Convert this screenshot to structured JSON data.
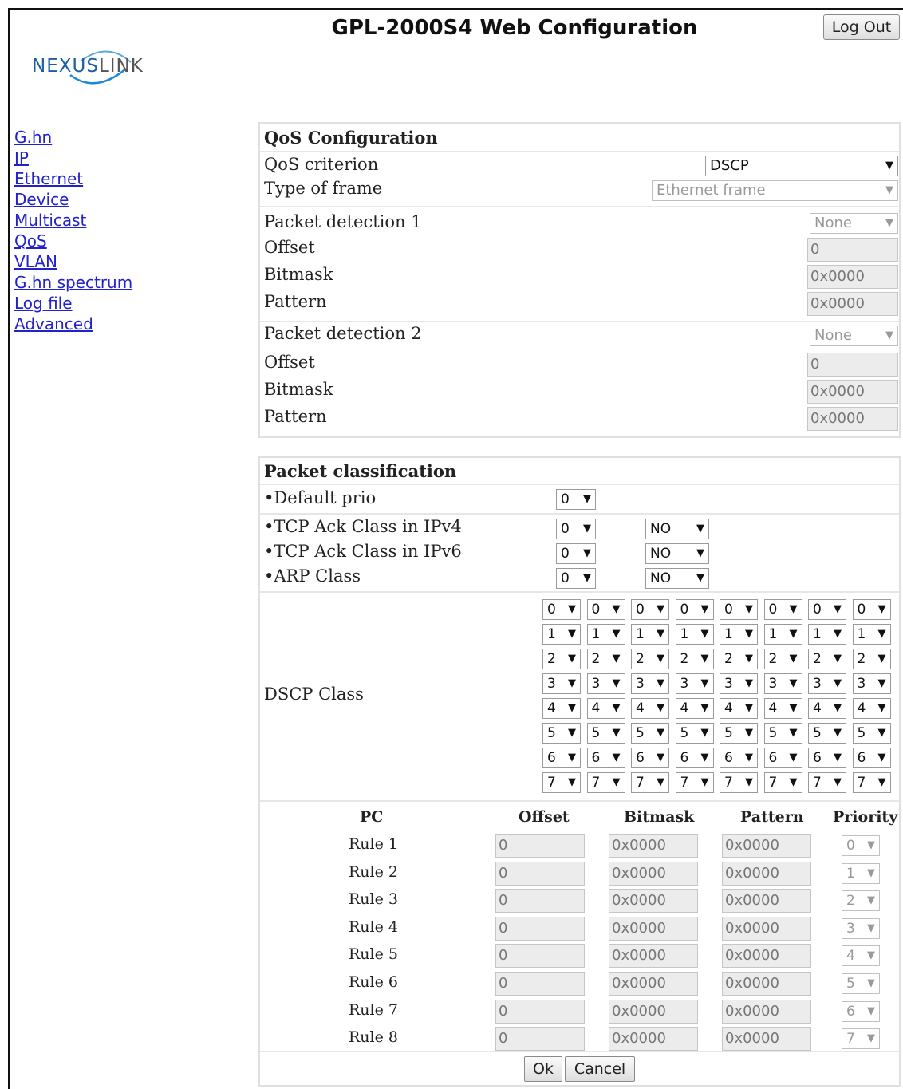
{
  "header": {
    "title": "GPL-2000S4 Web Configuration",
    "logout_label": "Log Out",
    "logo_prefix": "NEX",
    "logo_mid": "US",
    "logo_suffix": "LINK"
  },
  "nav": {
    "items": [
      "G.hn",
      "IP",
      "Ethernet",
      "Device",
      "Multicast",
      "QoS",
      "VLAN",
      "G.hn spectrum",
      "Log file",
      "Advanced"
    ]
  },
  "qos": {
    "title": "QoS Configuration",
    "criterion_label": "QoS criterion",
    "criterion_value": "DSCP",
    "frame_label": "Type of frame",
    "frame_value": "Ethernet frame",
    "detection1": {
      "label": "Packet detection 1",
      "mode": "None",
      "offset_label": "Offset",
      "offset": "0",
      "bitmask_label": "Bitmask",
      "bitmask": "0x0000",
      "pattern_label": "Pattern",
      "pattern": "0x0000"
    },
    "detection2": {
      "label": "Packet detection 2",
      "mode": "None",
      "offset_label": "Offset",
      "offset": "0",
      "bitmask_label": "Bitmask",
      "bitmask": "0x0000",
      "pattern_label": "Pattern",
      "pattern": "0x0000"
    }
  },
  "classification": {
    "title": "Packet classification",
    "default_prio_label": "•Default prio",
    "default_prio": "0",
    "tcp_ipv4_label": "•TCP Ack Class in IPv4",
    "tcp_ipv4_prio": "0",
    "tcp_ipv4_enable": "NO",
    "tcp_ipv6_label": "•TCP Ack Class in IPv6",
    "tcp_ipv6_prio": "0",
    "tcp_ipv6_enable": "NO",
    "arp_label": "•ARP Class",
    "arp_prio": "0",
    "arp_enable": "NO",
    "dscp_label": "DSCP Class",
    "dscp_rows": [
      [
        "0",
        "0",
        "0",
        "0",
        "0",
        "0",
        "0",
        "0"
      ],
      [
        "1",
        "1",
        "1",
        "1",
        "1",
        "1",
        "1",
        "1"
      ],
      [
        "2",
        "2",
        "2",
        "2",
        "2",
        "2",
        "2",
        "2"
      ],
      [
        "3",
        "3",
        "3",
        "3",
        "3",
        "3",
        "3",
        "3"
      ],
      [
        "4",
        "4",
        "4",
        "4",
        "4",
        "4",
        "4",
        "4"
      ],
      [
        "5",
        "5",
        "5",
        "5",
        "5",
        "5",
        "5",
        "5"
      ],
      [
        "6",
        "6",
        "6",
        "6",
        "6",
        "6",
        "6",
        "6"
      ],
      [
        "7",
        "7",
        "7",
        "7",
        "7",
        "7",
        "7",
        "7"
      ]
    ],
    "rules_headers": {
      "pc": "PC",
      "offset": "Offset",
      "bitmask": "Bitmask",
      "pattern": "Pattern",
      "priority": "Priority"
    },
    "rules": [
      {
        "name": "Rule 1",
        "offset": "0",
        "bitmask": "0x0000",
        "pattern": "0x0000",
        "priority": "0"
      },
      {
        "name": "Rule 2",
        "offset": "0",
        "bitmask": "0x0000",
        "pattern": "0x0000",
        "priority": "1"
      },
      {
        "name": "Rule 3",
        "offset": "0",
        "bitmask": "0x0000",
        "pattern": "0x0000",
        "priority": "2"
      },
      {
        "name": "Rule 4",
        "offset": "0",
        "bitmask": "0x0000",
        "pattern": "0x0000",
        "priority": "3"
      },
      {
        "name": "Rule 5",
        "offset": "0",
        "bitmask": "0x0000",
        "pattern": "0x0000",
        "priority": "4"
      },
      {
        "name": "Rule 6",
        "offset": "0",
        "bitmask": "0x0000",
        "pattern": "0x0000",
        "priority": "5"
      },
      {
        "name": "Rule 7",
        "offset": "0",
        "bitmask": "0x0000",
        "pattern": "0x0000",
        "priority": "6"
      },
      {
        "name": "Rule 8",
        "offset": "0",
        "bitmask": "0x0000",
        "pattern": "0x0000",
        "priority": "7"
      }
    ],
    "ok_label": "Ok",
    "cancel_label": "Cancel"
  }
}
